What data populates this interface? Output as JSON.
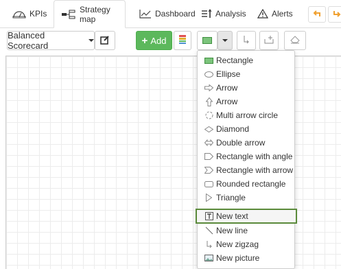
{
  "tabs": [
    {
      "label": "KPIs",
      "icon": "kpi-gauge-icon"
    },
    {
      "label": "Strategy map",
      "icon": "strategy-map-icon"
    },
    {
      "label": "Dashboard",
      "icon": "line-chart-icon"
    },
    {
      "label": "Analysis",
      "icon": "analysis-icon"
    },
    {
      "label": "Alerts",
      "icon": "warning-icon"
    }
  ],
  "toolbar": {
    "scorecard_label": "Balanced Scorecard",
    "add_label": "Add"
  },
  "colors": {
    "accent_green": "#5cb85c",
    "selected_outline": "#5a8a3a"
  },
  "menu": {
    "items": [
      {
        "label": "Rectangle",
        "icon": "rectangle-icon"
      },
      {
        "label": "Ellipse",
        "icon": "ellipse-icon"
      },
      {
        "label": "Arrow",
        "icon": "right-arrow-icon"
      },
      {
        "label": "Arrow",
        "icon": "up-arrow-icon"
      },
      {
        "label": "Multi arrow circle",
        "icon": "multi-arrow-circle-icon"
      },
      {
        "label": "Diamond",
        "icon": "diamond-icon"
      },
      {
        "label": "Double arrow",
        "icon": "double-arrow-icon"
      },
      {
        "label": "Rectangle with angle",
        "icon": "rectangle-angle-icon"
      },
      {
        "label": "Rectangle with arrow",
        "icon": "rectangle-arrow-icon"
      },
      {
        "label": "Rounded rectangle",
        "icon": "rounded-rectangle-icon"
      },
      {
        "label": "Triangle",
        "icon": "triangle-icon"
      },
      {
        "label": "New text",
        "icon": "text-icon"
      },
      {
        "label": "New line",
        "icon": "line-icon"
      },
      {
        "label": "New zigzag",
        "icon": "zigzag-icon"
      },
      {
        "label": "New picture",
        "icon": "picture-icon"
      }
    ],
    "selected_index": 11
  }
}
